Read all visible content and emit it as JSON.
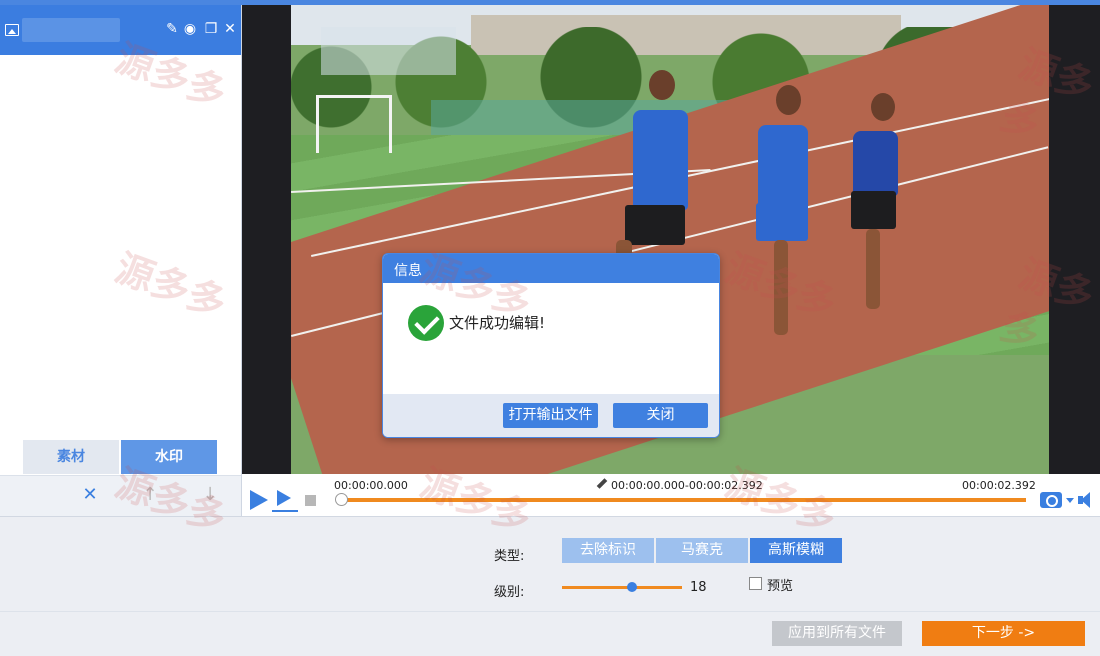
{
  "left_panel": {
    "tabs": [
      {
        "label": "素材",
        "active": false
      },
      {
        "label": "水印",
        "active": true
      }
    ],
    "tools": {
      "delete": "✕",
      "up": "↑",
      "down": "↓"
    }
  },
  "dialog": {
    "title": "信息",
    "message": "文件成功编辑!",
    "open_output_label": "打开输出文件",
    "close_label": "关闭"
  },
  "timeline": {
    "current_time": "00:00:00.000",
    "range": "00:00:00.000-00:00:02.392",
    "total_time": "00:00:02.392",
    "progress_fraction": 0.0
  },
  "settings": {
    "type_label": "类型:",
    "type_options": [
      {
        "label": "去除标识",
        "selected": false
      },
      {
        "label": "马赛克",
        "selected": false
      },
      {
        "label": "高斯模糊",
        "selected": true
      }
    ],
    "level_label": "级别:",
    "level_value": "18",
    "preview_label": "预览",
    "preview_checked": false
  },
  "footer": {
    "apply_all_label": "应用到所有文件",
    "next_label": "下一步 ->"
  },
  "watermark": {
    "text": "源多多"
  },
  "colors": {
    "accent": "#3f80e0",
    "orange": "#f08a1f",
    "header": "#3b7de0"
  }
}
